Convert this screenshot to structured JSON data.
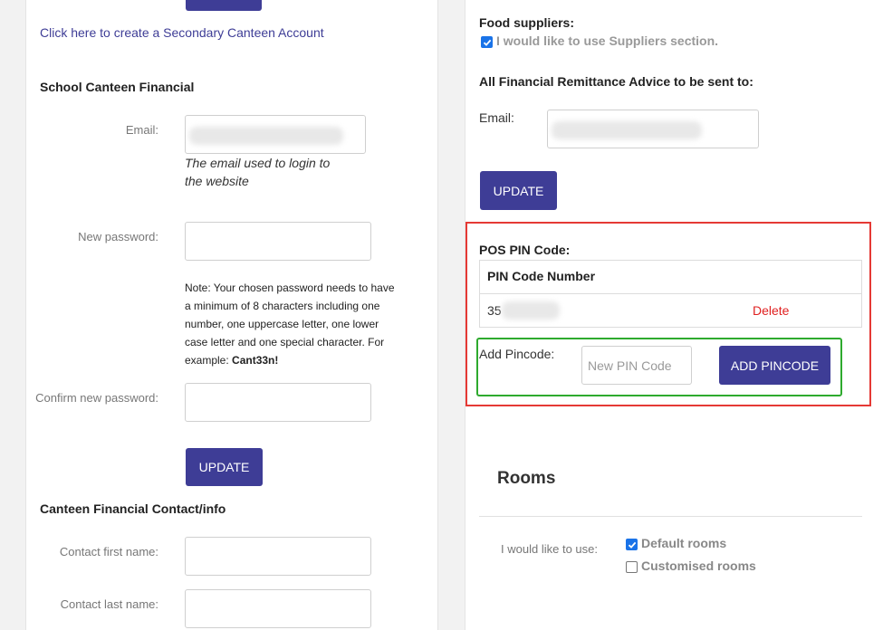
{
  "left": {
    "top_button_label": "",
    "secondary_link": "Click here to create a Secondary Canteen Account",
    "financial_heading": "School Canteen Financial",
    "email_label": "Email:",
    "email_hint": "The email used to login to the website",
    "new_password_label": "New password:",
    "password_note": "Note: Your chosen password needs to have a minimum of 8 characters including one number, one uppercase letter, one lower case letter and one special character. For example: ",
    "password_example": "Cant33n!",
    "confirm_password_label": "Confirm new password:",
    "update_label": "UPDATE",
    "contact_heading": "Canteen Financial Contact/info",
    "first_name_label": "Contact first name:",
    "last_name_label": "Contact last name:"
  },
  "right": {
    "food_suppliers_heading": "Food suppliers:",
    "suppliers_checkbox_label": "I would like to use Suppliers section.",
    "suppliers_checked": true,
    "remittance_heading": "All Financial Remittance Advice to be sent to:",
    "email_label": "Email:",
    "update_label": "UPDATE",
    "pos_heading": "POS PIN Code:",
    "pin_table": {
      "header": "PIN Code Number",
      "rows": [
        {
          "pin_visible": "35",
          "action": "Delete"
        }
      ]
    },
    "add_pincode_label": "Add Pincode:",
    "new_pin_placeholder": "New PIN Code",
    "add_pincode_button": "ADD PINCODE",
    "rooms_heading": "Rooms",
    "rooms_use_label": "I would like to use:",
    "rooms_options": [
      {
        "label": "Default rooms",
        "checked": true
      },
      {
        "label": "Customised rooms",
        "checked": false
      }
    ]
  },
  "colors": {
    "button": "#3e3d96",
    "link": "#3e3d96",
    "delete": "#e02020",
    "highlight_red": "#e53935",
    "highlight_green": "#2eaa2e",
    "checkbox": "#1a73e8"
  }
}
